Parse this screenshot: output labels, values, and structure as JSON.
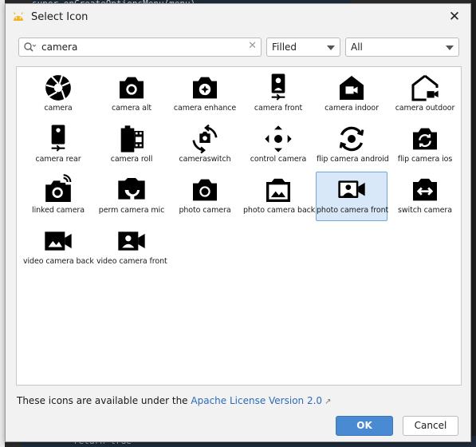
{
  "background": {
    "code_top": "super.onCreateOptionsMenu(menu)",
    "code_bottom": "return true"
  },
  "dialog": {
    "title": "Select Icon",
    "close_label": "✕"
  },
  "search": {
    "value": "camera",
    "placeholder": ""
  },
  "filters": {
    "style_selected": "Filled",
    "category_selected": "All"
  },
  "icons": [
    {
      "label": "camera",
      "icon": "camera-aperture-icon"
    },
    {
      "label": "camera alt",
      "icon": "camera-alt-icon"
    },
    {
      "label": "camera enhance",
      "icon": "camera-enhance-icon"
    },
    {
      "label": "camera front",
      "icon": "camera-front-icon"
    },
    {
      "label": "camera indoor",
      "icon": "camera-indoor-icon"
    },
    {
      "label": "camera outdoor",
      "icon": "camera-outdoor-icon"
    },
    {
      "label": "camera rear",
      "icon": "camera-rear-icon"
    },
    {
      "label": "camera roll",
      "icon": "camera-roll-icon"
    },
    {
      "label": "cameraswitch",
      "icon": "cameraswitch-icon"
    },
    {
      "label": "control camera",
      "icon": "control-camera-icon"
    },
    {
      "label": "flip camera android",
      "icon": "flip-camera-android-icon"
    },
    {
      "label": "flip camera ios",
      "icon": "flip-camera-ios-icon"
    },
    {
      "label": "linked camera",
      "icon": "linked-camera-icon"
    },
    {
      "label": "perm camera mic",
      "icon": "perm-camera-mic-icon"
    },
    {
      "label": "photo camera",
      "icon": "photo-camera-icon"
    },
    {
      "label": "photo camera back",
      "icon": "photo-camera-back-icon"
    },
    {
      "label": "photo camera front",
      "icon": "photo-camera-front-icon",
      "selected": true
    },
    {
      "label": "switch camera",
      "icon": "switch-camera-icon"
    },
    {
      "label": "video camera back",
      "icon": "video-camera-back-icon"
    },
    {
      "label": "video camera front",
      "icon": "video-camera-front-icon"
    }
  ],
  "footer": {
    "license_prefix": "These icons are available under the ",
    "license_link": "Apache License Version 2.0",
    "ok_label": "OK",
    "cancel_label": "Cancel"
  },
  "colors": {
    "accent": "#4a8ad3",
    "selection": "#d9e8f8",
    "link": "#2d6bb8"
  }
}
